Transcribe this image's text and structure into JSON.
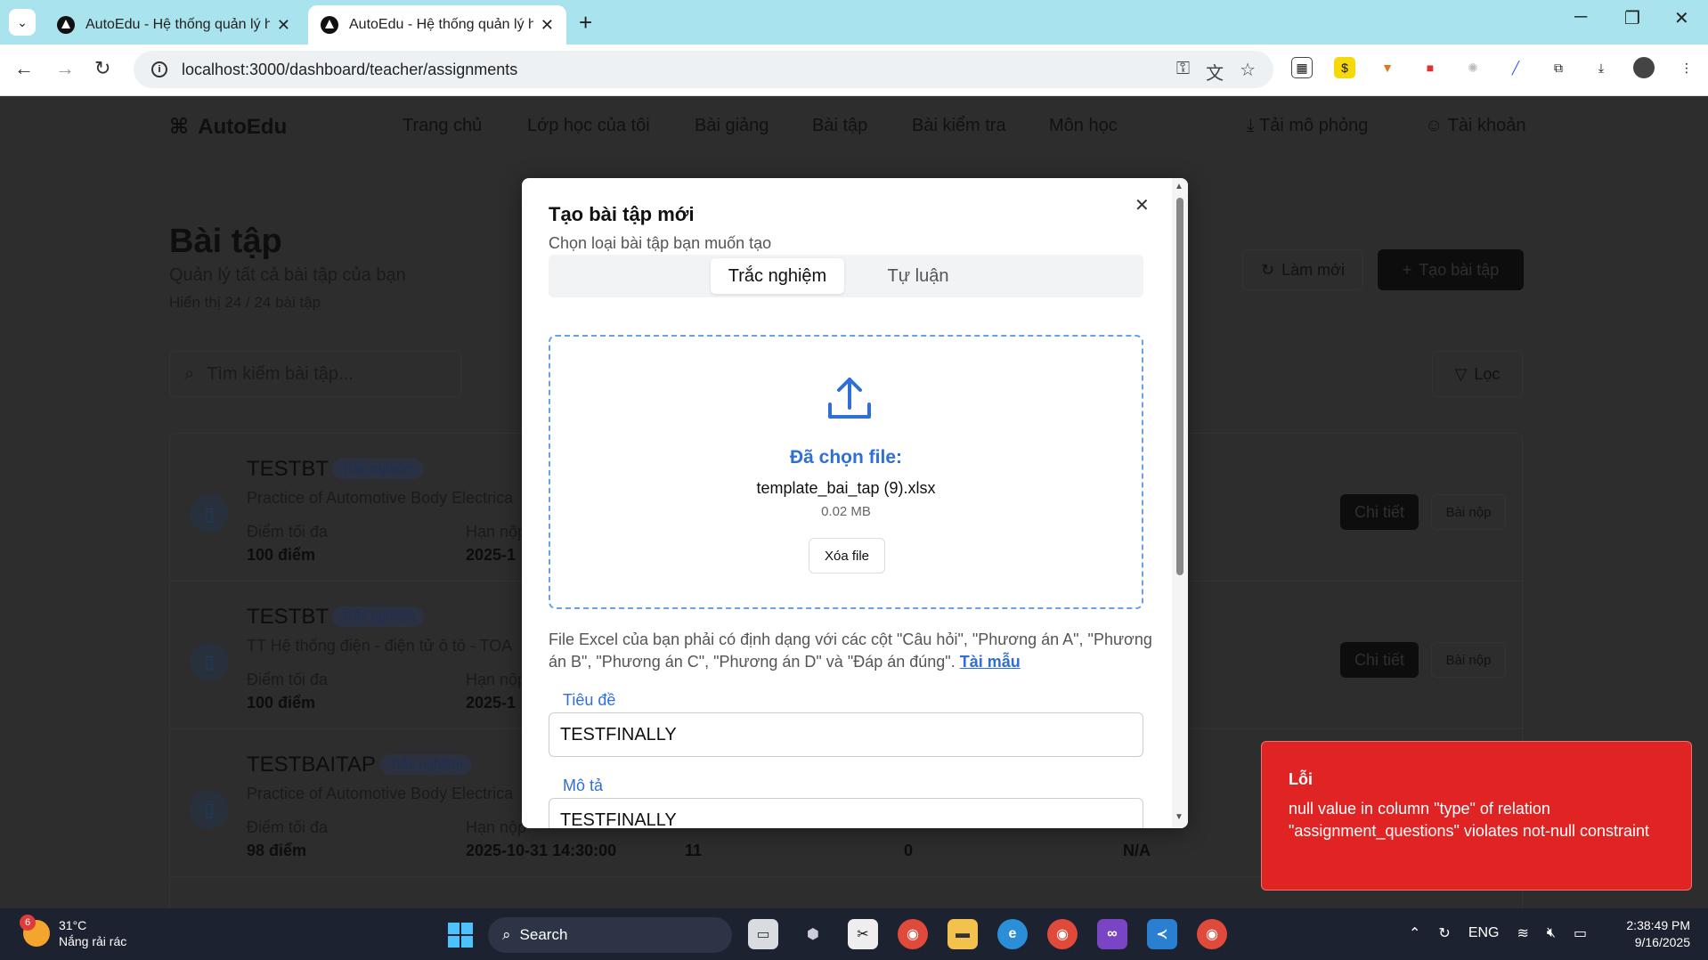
{
  "browser": {
    "tabs": [
      {
        "title": "AutoEdu - Hệ thống quản lý họ",
        "active": false
      },
      {
        "title": "AutoEdu - Hệ thống quản lý họ",
        "active": true
      }
    ],
    "url": "localhost:3000/dashboard/teacher/assignments"
  },
  "nav": {
    "brand": "AutoEdu",
    "items": [
      "Trang chủ",
      "Lớp học của tôi",
      "Bài giảng",
      "Bài tập",
      "Bài kiểm tra",
      "Môn học"
    ],
    "download": "Tải mô phỏng",
    "account": "Tài khoản"
  },
  "page": {
    "title": "Bài tập",
    "subtitle": "Quản lý tất cả bài tập của bạn",
    "count": "Hiển thị 24 / 24 bài tập",
    "refresh": "Làm mới",
    "create": "Tạo bài tập",
    "search_placeholder": "Tìm kiếm bài tập...",
    "filter": "Lọc",
    "detail_label": "Chi tiết",
    "submissions_label": "Bài nộp",
    "max_score_label": "Điểm tối đa",
    "deadline_label": "Hạn nộp",
    "assignments": [
      {
        "title": "TESTBT",
        "type": "Trắc nghiệm",
        "desc": "Practice of Automotive Body Electrica",
        "score": "100 điểm",
        "deadline": "2025-1"
      },
      {
        "title": "TESTBT",
        "type": "Trắc nghiệm",
        "desc": "TT Hệ thống điện - điện tử ô tô - TOA",
        "score": "100 điểm",
        "deadline": "2025-1"
      },
      {
        "title": "TESTBAITAP",
        "type": "Trắc nghiệm",
        "desc": "Practice of Automotive Body Electrica",
        "score": "98 điểm",
        "deadline": "2025-10-31 14:30:00",
        "questions": "11",
        "submissions": "0",
        "extra": "N/A"
      }
    ]
  },
  "modal": {
    "title": "Tạo bài tập mới",
    "subtitle": "Chọn loại bài tập bạn muốn tạo",
    "tab_multiple_choice": "Trắc nghiệm",
    "tab_essay": "Tự luận",
    "chosen_label": "Đã chọn file:",
    "file_name": "template_bai_tap (9).xlsx",
    "file_size": "0.02 MB",
    "remove_file": "Xóa file",
    "hint": "File Excel của bạn phải có định dạng với các cột \"Câu hỏi\", \"Phương án A\", \"Phương án B\", \"Phương án C\", \"Phương án D\" và \"Đáp án đúng\".",
    "template_link": "Tài mẫu",
    "title_label": "Tiêu đề",
    "title_value": "TESTFINALLY",
    "desc_label": "Mô tả",
    "desc_value": "TESTFINALLY"
  },
  "toast": {
    "title": "Lỗi",
    "message": "null value in column \"type\" of relation \"assignment_questions\" violates not-null constraint"
  },
  "taskbar": {
    "temp": "31°C",
    "weather": "Nắng rải rác",
    "weather_badge": "6",
    "search": "Search",
    "lang": "ENG",
    "time": "2:38:49 PM",
    "date": "9/16/2025"
  }
}
